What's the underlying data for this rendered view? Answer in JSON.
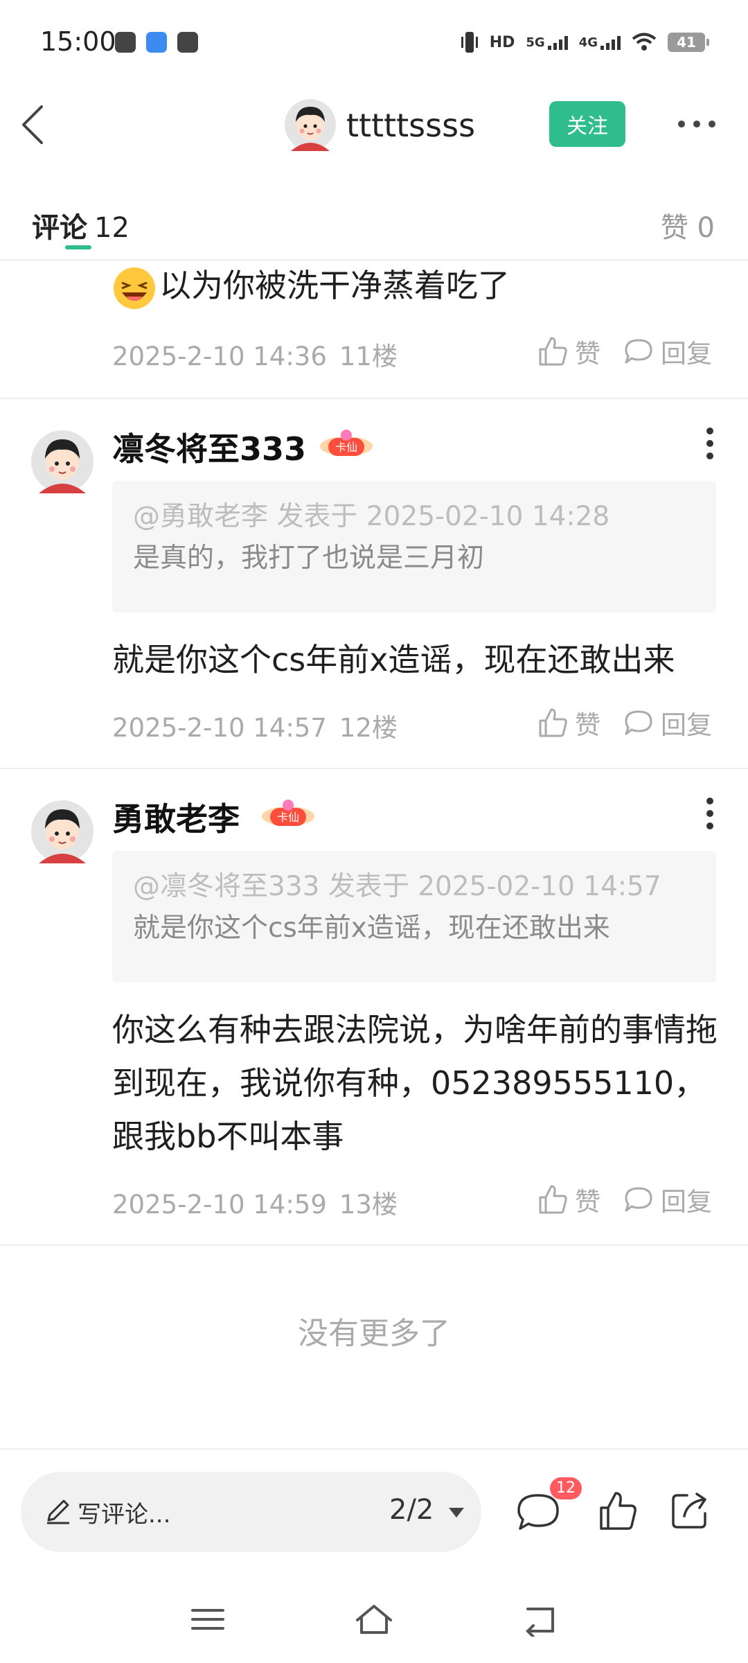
{
  "status_bar": {
    "time": "15:00",
    "hd_label": "HD",
    "net_5g": "5G",
    "net_4g": "4G",
    "battery": "41"
  },
  "header": {
    "username": "tttttssss",
    "follow_label": "关注"
  },
  "tabs": {
    "comments_label": "评论",
    "comments_count": "12",
    "likes_label": "赞 0"
  },
  "comments": [
    {
      "text": "以为你被洗干净蒸着吃了",
      "time": "2025-2-10 14:36",
      "floor": "11楼",
      "like_label": "赞",
      "reply_label": "回复"
    },
    {
      "author": "凛冬将至333",
      "badge": "卡仙",
      "quote_head": "@勇敢老李 发表于 2025-02-10 14:28",
      "quote_text": "是真的，我打了也说是三月初",
      "text": "就是你这个cs年前x造谣，现在还敢出来",
      "time": "2025-2-10 14:57",
      "floor": "12楼",
      "like_label": "赞",
      "reply_label": "回复"
    },
    {
      "author": "勇敢老李",
      "badge": "卡仙",
      "quote_head": "@凛冬将至333 发表于 2025-02-10 14:57",
      "quote_text": "就是你这个cs年前x造谣，现在还敢出来",
      "text": "你这么有种去跟法院说，为啥年前的事情拖到现在，我说你有种，052389555110，跟我bb不叫本事",
      "time": "2025-2-10 14:59",
      "floor": "13楼",
      "like_label": "赞",
      "reply_label": "回复"
    }
  ],
  "no_more_text": "没有更多了",
  "bottom_bar": {
    "compose_placeholder": "写评论...",
    "page_indicator": "2/2",
    "comment_count": "12"
  },
  "colors": {
    "accent": "#2fbd8e",
    "badge_red": "#ff5a5f",
    "muted_text": "#aaaaaa"
  },
  "icons": [
    "back-icon",
    "more-icon",
    "kebab-icon",
    "like-icon",
    "reply-icon",
    "pen-icon",
    "caret-down-icon",
    "comment-icon",
    "thumbs-up-icon",
    "share-icon",
    "menu-icon",
    "home-icon",
    "return-icon"
  ]
}
